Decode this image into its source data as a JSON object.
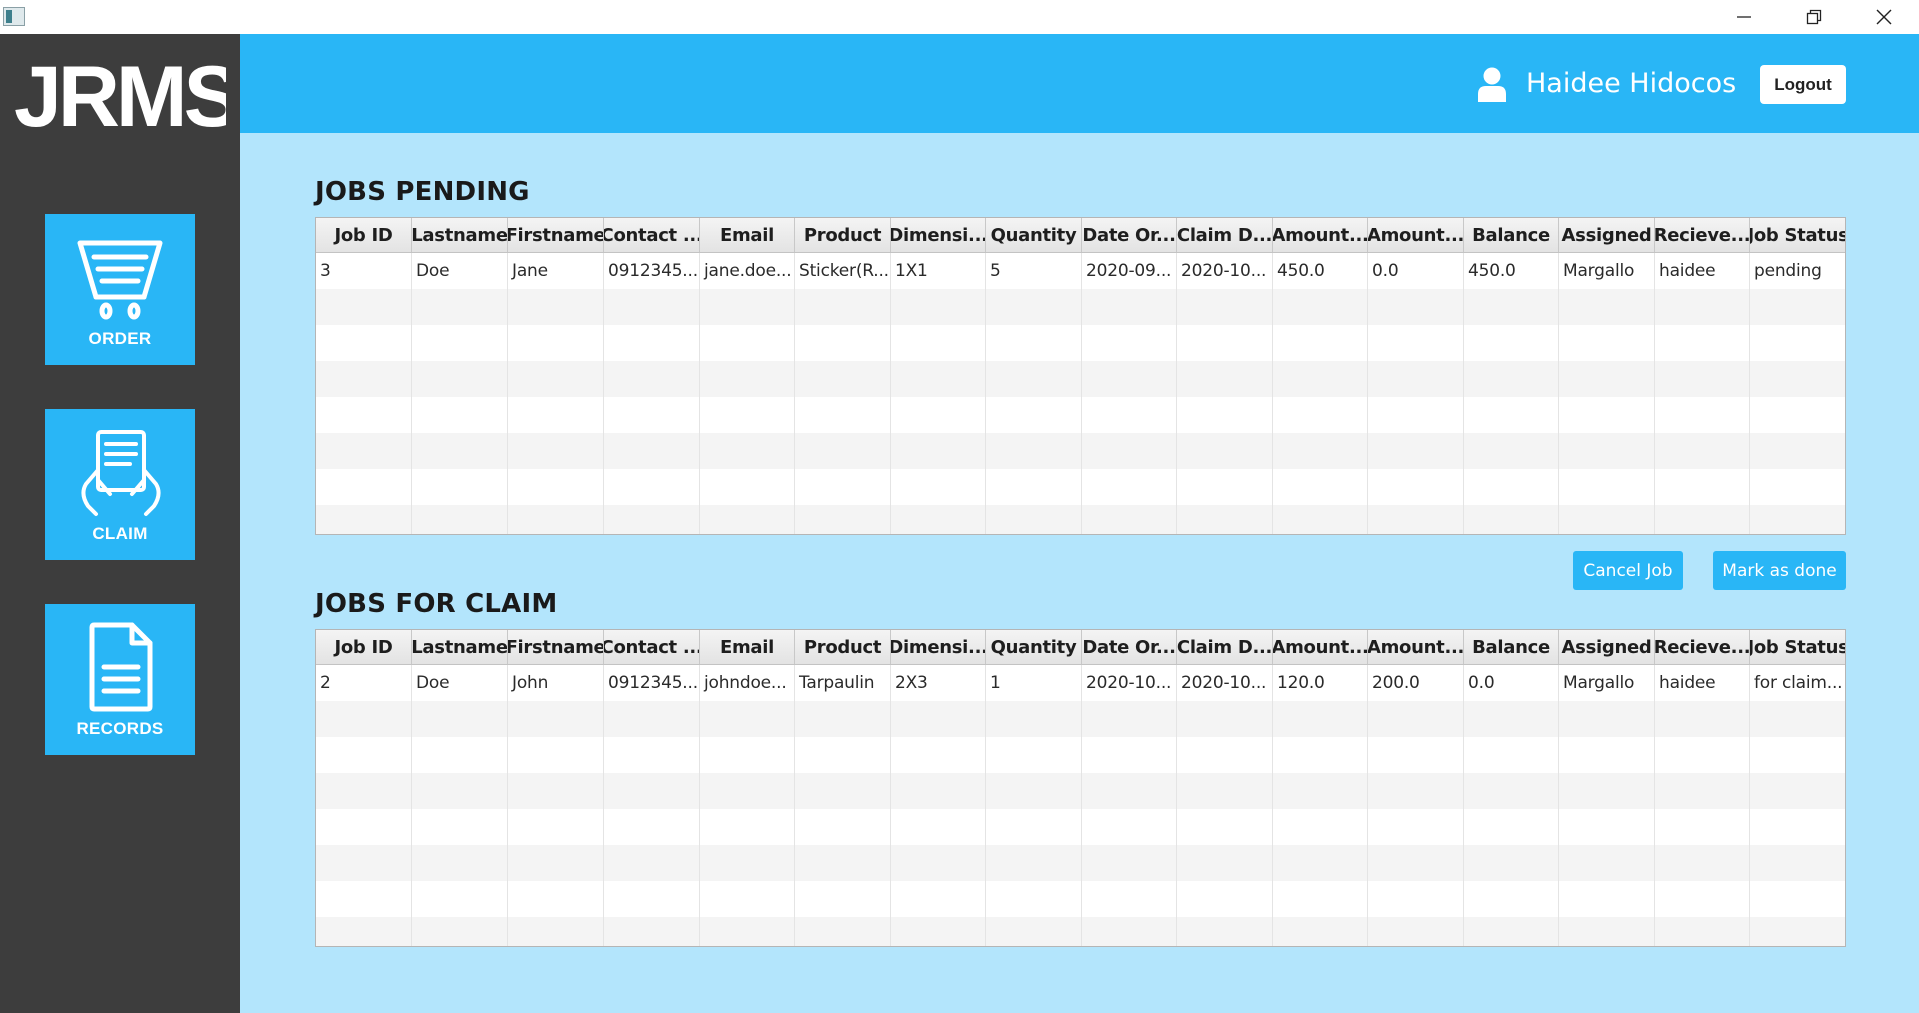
{
  "window": {
    "minimize_glyph": "—",
    "maximize_glyph": "❐",
    "close_glyph": "✕"
  },
  "sidebar": {
    "logo_text": "JRMS",
    "items": [
      {
        "label": "ORDER",
        "icon": "cart-icon"
      },
      {
        "label": "CLAIM",
        "icon": "claim-document-hands-icon"
      },
      {
        "label": "RECORDS",
        "icon": "document-icon"
      }
    ]
  },
  "header": {
    "user_name": "Haidee Hidocos",
    "logout_label": "Logout"
  },
  "colors": {
    "accent": "#29b6f6",
    "content_bg": "#b3e5fc",
    "sidebar_bg": "#3d3d3d"
  },
  "columns": [
    "Job ID",
    "Lastname",
    "Firstname",
    "Contact ...",
    "Email",
    "Product",
    "Dimensi...",
    "Quantity",
    "Date Or...",
    "Claim D...",
    "Amount...",
    "Amount...",
    "Balance",
    "Assigned",
    "Recieve...",
    "Job Status"
  ],
  "pending": {
    "title": "JOBS PENDING",
    "rows": [
      [
        "3",
        "Doe",
        "Jane",
        "0912345...",
        "jane.doe...",
        "Sticker(R...",
        "1X1",
        "5",
        "2020-09...",
        "2020-10...",
        "450.0",
        "0.0",
        "450.0",
        "Margallo",
        "haidee",
        "pending"
      ]
    ]
  },
  "actions": {
    "cancel_label": "Cancel Job",
    "done_label": "Mark as done"
  },
  "claim": {
    "title": "JOBS FOR CLAIM",
    "rows": [
      [
        "2",
        "Doe",
        "John",
        "0912345...",
        "johndoe...",
        "Tarpaulin",
        "2X3",
        "1",
        "2020-10...",
        "2020-10...",
        "120.0",
        "200.0",
        "0.0",
        "Margallo",
        "haidee",
        "for claim..."
      ]
    ]
  }
}
